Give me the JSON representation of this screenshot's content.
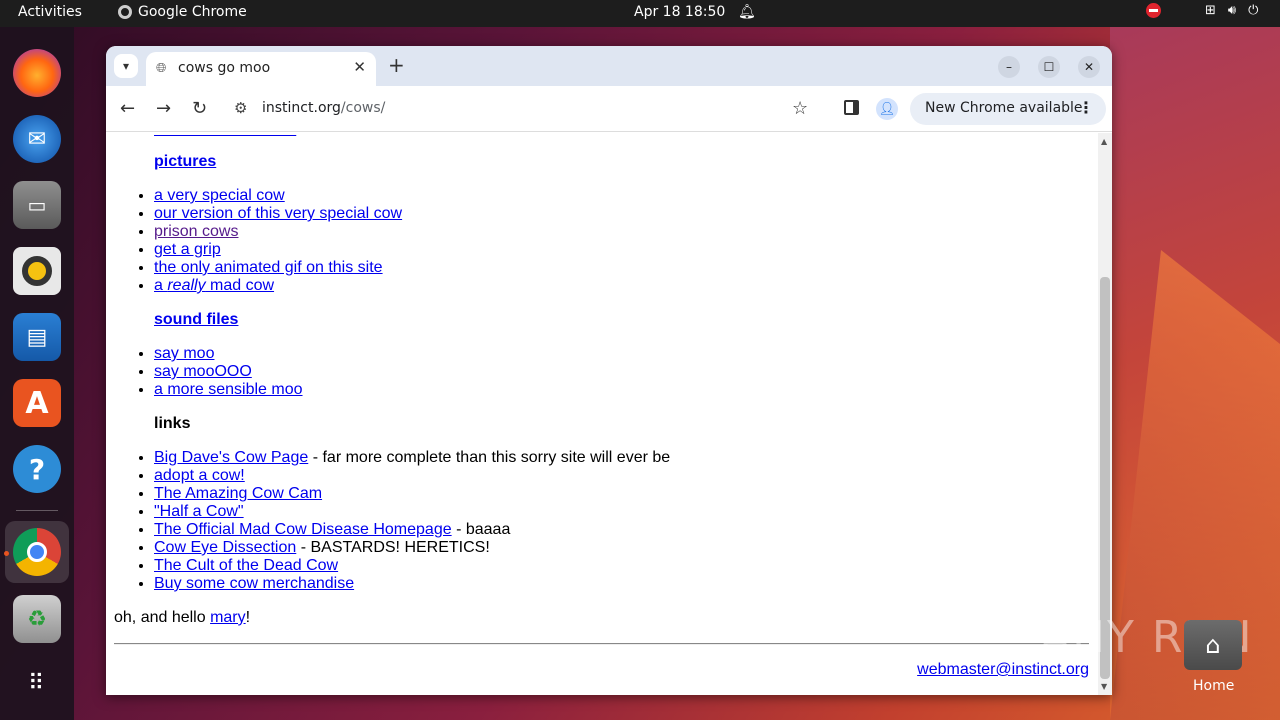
{
  "topbar": {
    "activities": "Activities",
    "app_name": "Google Chrome",
    "datetime": "Apr 18  18:50"
  },
  "dock": {
    "items": [
      "firefox-icon",
      "thunderbird-icon",
      "files-icon",
      "rhythmbox-icon",
      "writer-icon",
      "app-center-icon",
      "help-icon",
      "chrome-icon",
      "trash-icon",
      "app-grid-icon"
    ]
  },
  "browser": {
    "tab_title": "cows go moo",
    "url_host": "instinct.org",
    "url_path": "/cows/",
    "update_label": "New Chrome available"
  },
  "page": {
    "pictures_heading": "pictures",
    "pictures": [
      {
        "text": "a very special cow"
      },
      {
        "text": "our version of this very special cow"
      },
      {
        "text": "prison cows"
      },
      {
        "text": "get a grip"
      },
      {
        "text": "the only animated gif on this site"
      }
    ],
    "mad_cow": {
      "pre": "a ",
      "em": "really",
      "post": " mad cow"
    },
    "sound_heading": "sound files",
    "sounds": [
      {
        "text": "say moo"
      },
      {
        "text": "say mooOOO"
      },
      {
        "text": "a more sensible moo"
      }
    ],
    "links_heading": "links",
    "links": [
      {
        "text": "Big Dave's Cow Page",
        "suffix": " - far more complete than this sorry site will ever be"
      },
      {
        "text": "adopt a cow!",
        "suffix": ""
      },
      {
        "text": "The Amazing Cow Cam",
        "suffix": ""
      },
      {
        "text": "\"Half a Cow\"",
        "suffix": ""
      },
      {
        "text": "The Official Mad Cow Disease Homepage",
        "suffix": " - baaaa"
      },
      {
        "text": "Cow Eye Dissection",
        "suffix": " - BASTARDS! HERETICS!"
      },
      {
        "text": "The Cult of the Dead Cow",
        "suffix": ""
      },
      {
        "text": "Buy some cow merchandise",
        "suffix": ""
      }
    ],
    "hello_pre": "oh, and hello ",
    "hello_link": "mary",
    "hello_post": "!",
    "webmaster": "webmaster@instinct.org"
  },
  "desktop": {
    "home_label": "Home",
    "watermark": "ANY RUN"
  },
  "colors": {
    "link": "#0000ee",
    "visited": "#551a8b",
    "accent": "#e95420"
  }
}
